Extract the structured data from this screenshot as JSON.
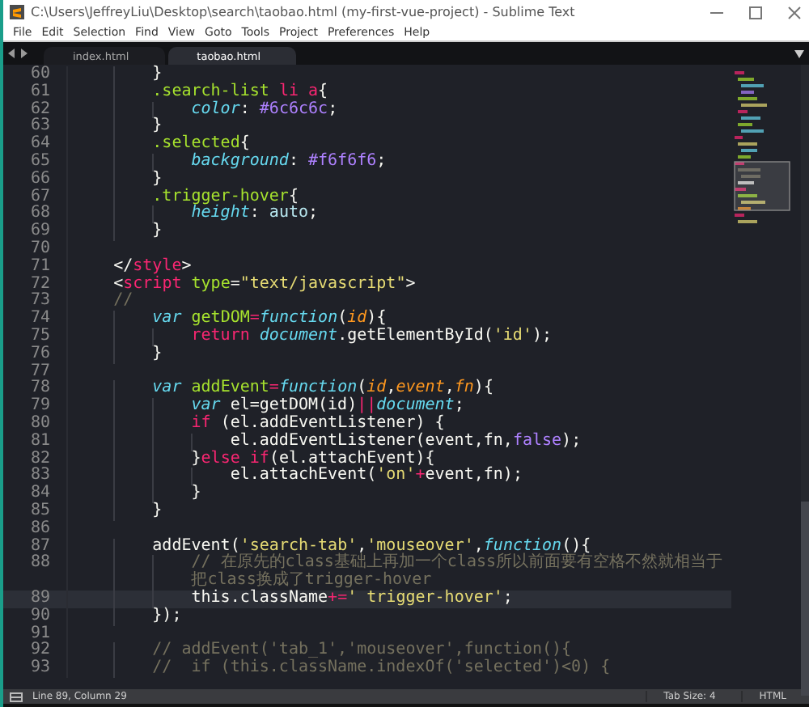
{
  "window": {
    "title": "C:\\Users\\JeffreyLiu\\Desktop\\search\\taobao.html (my-first-vue-project) - Sublime Text"
  },
  "menu": [
    "File",
    "Edit",
    "Selection",
    "Find",
    "View",
    "Goto",
    "Tools",
    "Project",
    "Preferences",
    "Help"
  ],
  "tabs": [
    {
      "label": "index.html",
      "selected": false
    },
    {
      "label": "taobao.html",
      "selected": true
    }
  ],
  "lines": [
    {
      "number": "60",
      "tokens": [
        {
          "kind": "plain",
          "text": "        }"
        }
      ]
    },
    {
      "number": "61",
      "tokens": [
        {
          "kind": "selector",
          "text": "        .search-list"
        },
        {
          "kind": "tag",
          "text": " li"
        },
        {
          "kind": "tag",
          "text": " a"
        },
        {
          "kind": "plain",
          "text": "{"
        }
      ]
    },
    {
      "number": "62",
      "tokens": [
        {
          "kind": "property",
          "text": "            color"
        },
        {
          "kind": "plain",
          "text": ": "
        },
        {
          "kind": "constant",
          "text": "#6c6c6c"
        },
        {
          "kind": "plain",
          "text": ";"
        }
      ]
    },
    {
      "number": "63",
      "tokens": [
        {
          "kind": "plain",
          "text": "        }"
        }
      ]
    },
    {
      "number": "64",
      "tokens": [
        {
          "kind": "selector",
          "text": "        .selected"
        },
        {
          "kind": "plain",
          "text": "{"
        }
      ]
    },
    {
      "number": "65",
      "tokens": [
        {
          "kind": "property",
          "text": "            background"
        },
        {
          "kind": "plain",
          "text": ": "
        },
        {
          "kind": "constant",
          "text": "#f6f6f6"
        },
        {
          "kind": "plain",
          "text": ";"
        }
      ]
    },
    {
      "number": "66",
      "tokens": [
        {
          "kind": "plain",
          "text": "        }"
        }
      ]
    },
    {
      "number": "67",
      "tokens": [
        {
          "kind": "selector",
          "text": "        .trigger-hover"
        },
        {
          "kind": "plain",
          "text": "{"
        }
      ]
    },
    {
      "number": "68",
      "tokens": [
        {
          "kind": "property",
          "text": "            height"
        },
        {
          "kind": "plain",
          "text": ": "
        },
        {
          "kind": "value",
          "text": "auto"
        },
        {
          "kind": "plain",
          "text": ";"
        }
      ]
    },
    {
      "number": "69",
      "tokens": [
        {
          "kind": "plain",
          "text": "        }"
        }
      ]
    },
    {
      "number": "70"
    },
    {
      "number": "71",
      "tokens": [
        {
          "kind": "plain",
          "text": "    </"
        },
        {
          "kind": "tag",
          "text": "style"
        },
        {
          "kind": "plain",
          "text": ">"
        }
      ]
    },
    {
      "number": "72",
      "tokens": [
        {
          "kind": "plain",
          "text": "    <"
        },
        {
          "kind": "tag",
          "text": "script"
        },
        {
          "kind": "attribute",
          "text": " type"
        },
        {
          "kind": "plain",
          "text": "="
        },
        {
          "kind": "string",
          "text": "\"text/javascript\""
        },
        {
          "kind": "plain",
          "text": ">"
        }
      ]
    },
    {
      "number": "73",
      "tokens": [
        {
          "kind": "comment",
          "text": "    //"
        }
      ]
    },
    {
      "number": "74",
      "tokens": [
        {
          "kind": "storage",
          "text": "        var"
        },
        {
          "kind": "function",
          "text": " getDOM"
        },
        {
          "kind": "operator",
          "text": "="
        },
        {
          "kind": "storage",
          "text": "function"
        },
        {
          "kind": "plain",
          "text": "("
        },
        {
          "kind": "parameter",
          "text": "id"
        },
        {
          "kind": "plain",
          "text": "){"
        }
      ]
    },
    {
      "number": "75",
      "tokens": [
        {
          "kind": "keyword",
          "text": "            return"
        },
        {
          "kind": "support",
          "text": " document"
        },
        {
          "kind": "plain",
          "text": ".getElementById("
        },
        {
          "kind": "string",
          "text": "'id'"
        },
        {
          "kind": "plain",
          "text": ");"
        }
      ]
    },
    {
      "number": "76",
      "tokens": [
        {
          "kind": "plain",
          "text": "        }"
        }
      ]
    },
    {
      "number": "77"
    },
    {
      "number": "78",
      "tokens": [
        {
          "kind": "storage",
          "text": "        var"
        },
        {
          "kind": "function",
          "text": " addEvent"
        },
        {
          "kind": "operator",
          "text": "="
        },
        {
          "kind": "storage",
          "text": "function"
        },
        {
          "kind": "plain",
          "text": "("
        },
        {
          "kind": "parameter",
          "text": "id"
        },
        {
          "kind": "plain",
          "text": ","
        },
        {
          "kind": "parameter",
          "text": "event"
        },
        {
          "kind": "plain",
          "text": ","
        },
        {
          "kind": "parameter",
          "text": "fn"
        },
        {
          "kind": "plain",
          "text": "){"
        }
      ]
    },
    {
      "number": "79",
      "tokens": [
        {
          "kind": "storage",
          "text": "            var"
        },
        {
          "kind": "plain",
          "text": " el=getDOM(id)"
        },
        {
          "kind": "operator",
          "text": "||"
        },
        {
          "kind": "support",
          "text": "document"
        },
        {
          "kind": "plain",
          "text": ";"
        }
      ]
    },
    {
      "number": "80",
      "tokens": [
        {
          "kind": "keyword",
          "text": "            if"
        },
        {
          "kind": "plain",
          "text": " (el.addEventListener) {"
        }
      ]
    },
    {
      "number": "81",
      "tokens": [
        {
          "kind": "plain",
          "text": "                el.addEventListener(event,fn,"
        },
        {
          "kind": "constant",
          "text": "false"
        },
        {
          "kind": "plain",
          "text": ");"
        }
      ]
    },
    {
      "number": "82",
      "tokens": [
        {
          "kind": "plain",
          "text": "            }"
        },
        {
          "kind": "keyword",
          "text": "else"
        },
        {
          "kind": "keyword",
          "text": " if"
        },
        {
          "kind": "plain",
          "text": "(el.attachEvent){"
        }
      ]
    },
    {
      "number": "83",
      "tokens": [
        {
          "kind": "plain",
          "text": "                el.attachEvent("
        },
        {
          "kind": "string",
          "text": "'on'"
        },
        {
          "kind": "operator",
          "text": "+"
        },
        {
          "kind": "plain",
          "text": "event,fn);"
        }
      ]
    },
    {
      "number": "84",
      "tokens": [
        {
          "kind": "plain",
          "text": "            }"
        }
      ]
    },
    {
      "number": "85",
      "tokens": [
        {
          "kind": "plain",
          "text": "        }"
        }
      ]
    },
    {
      "number": "86"
    },
    {
      "number": "87",
      "tokens": [
        {
          "kind": "plain",
          "text": "        addEvent("
        },
        {
          "kind": "string",
          "text": "'search-tab'"
        },
        {
          "kind": "plain",
          "text": ","
        },
        {
          "kind": "string",
          "text": "'mouseover'"
        },
        {
          "kind": "plain",
          "text": ","
        },
        {
          "kind": "storage",
          "text": "function"
        },
        {
          "kind": "plain",
          "text": "(){"
        }
      ]
    },
    {
      "number": "88",
      "tokens": [
        {
          "kind": "comment",
          "text": "            // 在原先的class基础上再加一个class所以前面要有空格不然就相当于"
        }
      ],
      "continuation": [
        {
          "kind": "comment",
          "text": "            把class换成了trigger-hover"
        }
      ]
    },
    {
      "number": "89",
      "current": true,
      "tokens": [
        {
          "kind": "plain",
          "text": "            this.className"
        },
        {
          "kind": "operator",
          "text": "+="
        },
        {
          "kind": "string",
          "text": "' trigger-hover'"
        },
        {
          "kind": "plain",
          "text": ";"
        }
      ]
    },
    {
      "number": "90",
      "tokens": [
        {
          "kind": "plain",
          "text": "        });"
        }
      ]
    },
    {
      "number": "91"
    },
    {
      "number": "92",
      "tokens": [
        {
          "kind": "comment",
          "text": "        // addEvent('tab_1','mouseover',function(){"
        }
      ]
    },
    {
      "number": "93",
      "tokens": [
        {
          "kind": "comment",
          "text": "        //  if (this.className.indexOf('selected')<0) {"
        }
      ]
    }
  ],
  "status_bar": {
    "position": "Line 89, Column 29",
    "tab_size": "Tab Size: 4",
    "syntax": "HTML"
  }
}
